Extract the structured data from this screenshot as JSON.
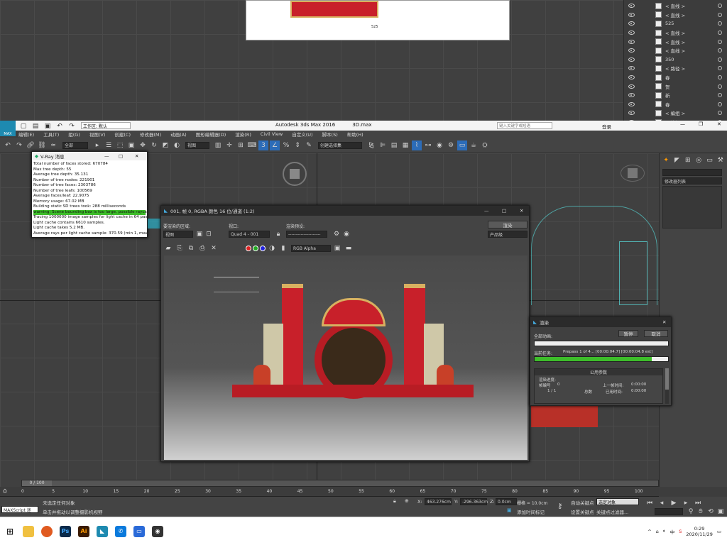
{
  "layers": {
    "rows": [
      "< 直线 >",
      "< 直线 >",
      "525",
      "< 直线 >",
      "< 直线 >",
      "< 直线 >",
      "350",
      "< 路径 >",
      "春",
      "贺",
      "新",
      "春",
      "< 编组 >",
      "< 编组 >"
    ]
  },
  "app": {
    "title": "Autodesk 3ds Max 2016",
    "file": "3D.max",
    "workspace": "工作区: 默认",
    "search_placeholder": "键入关键字或短语",
    "login": "登录"
  },
  "menu": [
    "编辑(E)",
    "工具(T)",
    "组(G)",
    "视图(V)",
    "创建(C)",
    "修改器(M)",
    "动画(A)",
    "图形编辑器(D)",
    "渲染(R)",
    "Civil View",
    "自定义(U)",
    "脚本(S)",
    "帮助(H)"
  ],
  "toolbar": {
    "filter": "全部",
    "viewport_ref": "视图",
    "selset": "创建选择集"
  },
  "modifier_list": "修改器列表",
  "vray": {
    "title": "V-Ray 消息",
    "lines": [
      "Total number of faces stored: 670784",
      "Max tree depth: 55",
      "Average tree depth: 35.131",
      "Number of tree nodes: 221901",
      "Number of tree faces: 2303786",
      "Number of tree leafs: 100569",
      "Average faces/leaf: 22.9075",
      "Memory usage: 67.02 MB",
      "Building static SD trees took: 288 milliseconds"
    ],
    "warning": "warning: Scene bounding box is too large, possible raycast e",
    "lines2": [
      "Tracing 1000000 image samples for light cache in 64 passes",
      "Light cache contains 6610 samples.",
      "Light cache takes 5.2 MB.",
      "Average rays per light cache sample: 370.59 (min 1, max 2"
    ]
  },
  "fb": {
    "title": "001, 帧 0, RGBA 颜色 16 位/通道 (1:2)",
    "area_label": "要渲染的区域:",
    "area_val": "视图",
    "viewport_label": "视口:",
    "viewport_val": "Quad 4 - 001",
    "preset_label": "渲染预设:",
    "preset_val": "---------------------",
    "render_btn": "渲染",
    "product": "产品级",
    "channel": "RGB Alpha"
  },
  "dim_label": "525",
  "render": {
    "title": "渲染",
    "total": "全部动画:",
    "pause": "暂停",
    "cancel": "取消",
    "current": "当前任务:",
    "task": "Prepass 1 of 4... [00:00:04.7] [00:00:04.8 est]",
    "progress_top": 0.0,
    "progress": 0.88,
    "params_title": "公用参数",
    "render_progress": "渲染进度:",
    "frame_no": "帧编号",
    "frame_val": "0",
    "frame_total": "1 / 1",
    "total_lbl": "总数",
    "last_time": "上一帧时间:",
    "last_val": "0:00:00",
    "elapsed": "已用时间:",
    "elapsed_val": "0:00:00"
  },
  "timeline": {
    "frame": "0 / 100",
    "ticks": [
      "0",
      "5",
      "10",
      "15",
      "20",
      "25",
      "30",
      "35",
      "40",
      "45",
      "50",
      "55",
      "60",
      "65",
      "70",
      "75",
      "80",
      "85",
      "90",
      "95",
      "100"
    ]
  },
  "status": {
    "script": "MAXScript 迷",
    "none": "未选定任何对象",
    "hint": "单击并拖动以调整摄影机视野",
    "x": "463.276cm",
    "y": "-296.363cm",
    "z": "0.0cm",
    "grid": "栅格 = 10.0cm",
    "auto_key": "自动关键点",
    "set_key": "设置关键点",
    "sel_obj": "选定对象",
    "key_filters": "关键点过滤器...",
    "add_time": "添加时间标记"
  },
  "taskbar": {
    "time": "0:29",
    "date": "2020/11/29",
    "ime": "中"
  },
  "colors": {
    "accent": "#3dbd2a",
    "banner": "#c8202a",
    "gold": "#d8b060"
  }
}
